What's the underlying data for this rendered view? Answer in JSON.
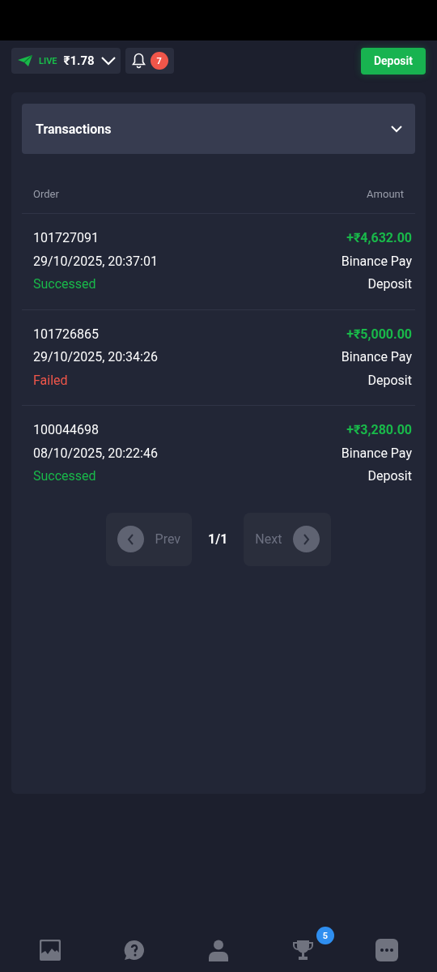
{
  "header": {
    "mode": "LIVE",
    "balance": "₹1.78",
    "notifications": "7",
    "deposit_button": "Deposit"
  },
  "panel": {
    "title": "Transactions",
    "expanded": false
  },
  "table": {
    "columns": [
      "Order",
      "Amount"
    ],
    "rows": [
      {
        "order": "101727091",
        "date": "29/10/2025, 20:37:01",
        "status": "Successed",
        "kind": "success",
        "amount": "+₹4,632.00",
        "method": "Binance Pay",
        "type": "Deposit"
      },
      {
        "order": "101726865",
        "date": "29/10/2025, 20:34:26",
        "status": "Failed",
        "kind": "failed",
        "amount": "+₹5,000.00",
        "method": "Binance Pay",
        "type": "Deposit"
      },
      {
        "order": "100044698",
        "date": "08/10/2025, 20:22:46",
        "status": "Successed",
        "kind": "success",
        "amount": "+₹3,280.00",
        "method": "Binance Pay",
        "type": "Deposit"
      }
    ]
  },
  "pagination": {
    "prev": {
      "label": "Prev",
      "disabled": true
    },
    "page": "1/1",
    "next": {
      "label": "Next",
      "disabled": true
    }
  },
  "bottom_nav": [
    {
      "kind": "chart"
    },
    {
      "kind": "help"
    },
    {
      "kind": "profile"
    },
    {
      "kind": "trophy",
      "badge": "5"
    },
    {
      "kind": "more"
    }
  ]
}
